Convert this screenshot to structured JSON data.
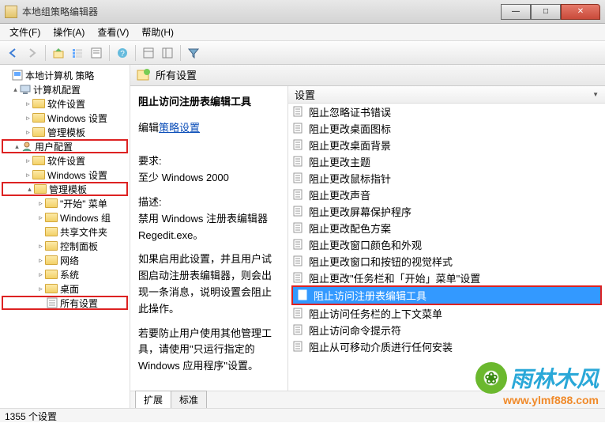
{
  "window": {
    "title": "本地组策略编辑器"
  },
  "menus": {
    "file": "文件(F)",
    "action": "操作(A)",
    "view": "查看(V)",
    "help": "帮助(H)"
  },
  "tree": {
    "root": "本地计算机 策略",
    "computer_config": "计算机配置",
    "cc_software": "软件设置",
    "cc_windows": "Windows 设置",
    "cc_admin": "管理模板",
    "user_config": "用户配置",
    "uc_software": "软件设置",
    "uc_windows": "Windows 设置",
    "uc_admin": "管理模板",
    "start_menu": "\"开始\" 菜单",
    "windows_comp": "Windows 组",
    "shared": "共享文件夹",
    "control_panel": "控制面板",
    "network": "网络",
    "system": "系统",
    "desktop": "桌面",
    "all_settings": "所有设置"
  },
  "header": {
    "title": "所有设置"
  },
  "detail": {
    "title": "阻止访问注册表编辑工具",
    "edit_prefix": "编辑",
    "edit_link": "策略设置",
    "req_label": "要求:",
    "req_value": "至少 Windows 2000",
    "desc_label": "描述:",
    "desc_1": "禁用 Windows 注册表编辑器 Regedit.exe。",
    "desc_2": "如果启用此设置，并且用户试图启动注册表编辑器，则会出现一条消息，说明设置会阻止此操作。",
    "desc_3": "若要防止用户使用其他管理工具，请使用\"只运行指定的 Windows 应用程序\"设置。"
  },
  "list": {
    "header": "设置",
    "items": [
      "阻止忽略证书错误",
      "阻止更改桌面图标",
      "阻止更改桌面背景",
      "阻止更改主题",
      "阻止更改鼠标指针",
      "阻止更改声音",
      "阻止更改屏幕保护程序",
      "阻止更改配色方案",
      "阻止更改窗口颜色和外观",
      "阻止更改窗口和按钮的视觉样式",
      "阻止更改\"任务栏和「开始」菜单\"设置",
      "阻止访问注册表编辑工具",
      "阻止访问任务栏的上下文菜单",
      "阻止访问命令提示符",
      "阻止从可移动介质进行任何安装"
    ],
    "selected_index": 11
  },
  "tabs": {
    "extended": "扩展",
    "standard": "标准"
  },
  "status": "1355 个设置",
  "watermark": {
    "brand": "雨林木风",
    "url": "www.ylmf888.com"
  }
}
